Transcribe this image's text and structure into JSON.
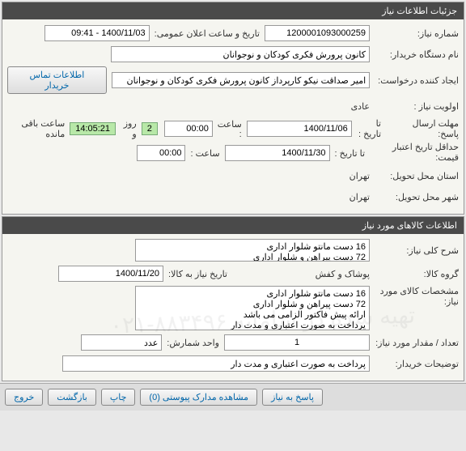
{
  "panels": {
    "need_info": {
      "header": "جزئیات اطلاعات نیاز",
      "need_number_label": "شماره نیاز:",
      "need_number": "1200001093000259",
      "announce_label": "تاریخ و ساعت اعلان عمومی:",
      "announce_date": "1400/11/03 - 09:41",
      "buyer_label": "نام دستگاه خریدار:",
      "buyer": "کانون پرورش فکری کودکان و نوجوانان",
      "creator_label": "ایجاد کننده درخواست:",
      "creator": "امیر صداقت نیکو کارپرداز کانون پرورش فکری کودکان و نوجوانان",
      "contact_btn": "اطلاعات تماس خریدار",
      "priority_label": "اولویت نیاز :",
      "priority": "عادی",
      "response_deadline_label": "مهلت ارسال پاسخ:",
      "until_label": "تا تاریخ :",
      "response_date": "1400/11/06",
      "time_label": "ساعت :",
      "response_time": "00:00",
      "days_left": "2",
      "days_unit": "روز و",
      "time_left": "14:05:21",
      "remaining_label": "ساعت باقی مانده",
      "price_validity_label": "حداقل تاریخ اعتبار قیمت:",
      "price_date": "1400/11/30",
      "price_time": "00:00",
      "delivery_province_label": "استان محل تحویل:",
      "delivery_province": "تهران",
      "delivery_city_label": "شهر محل تحویل:",
      "delivery_city": "تهران"
    },
    "goods_info": {
      "header": "اطلاعات کالاهای مورد نیاز",
      "desc_label": "شرح کلی نیاز:",
      "desc": "16 دست مانتو شلوار اداری\n72 دست پیراهن و شلوار اداری",
      "group_label": "گروه کالا:",
      "group": "پوشاک و کفش",
      "need_by_label": "تاریخ نیاز به کالا:",
      "need_by_date": "1400/11/20",
      "spec_label": "مشخصات کالای مورد نیاز:",
      "spec": "16 دست مانتو شلوار اداری\n72 دست پیراهن و شلوار اداری\nارائه پیش فاکتور الزامی می باشد\nپرداخت به صورت اعتباری و مدت دار",
      "qty_label": "تعداد / مقدار مورد نیاز:",
      "qty": "1",
      "unit_label": "واحد شمارش:",
      "unit": "عدد",
      "buyer_notes_label": "توضیحات خریدار:",
      "buyer_notes": "پرداخت به صورت اعتباری و مدت دار"
    }
  },
  "buttons": {
    "respond": "پاسخ به نیاز",
    "attachments": "مشاهده مدارک پیوستی  (0)",
    "print": "چاپ",
    "back": "بازگشت",
    "exit": "خروج"
  },
  "watermark": "تهیه شده در سامانه ۸۸۳۴۹۶-۰۲۱"
}
